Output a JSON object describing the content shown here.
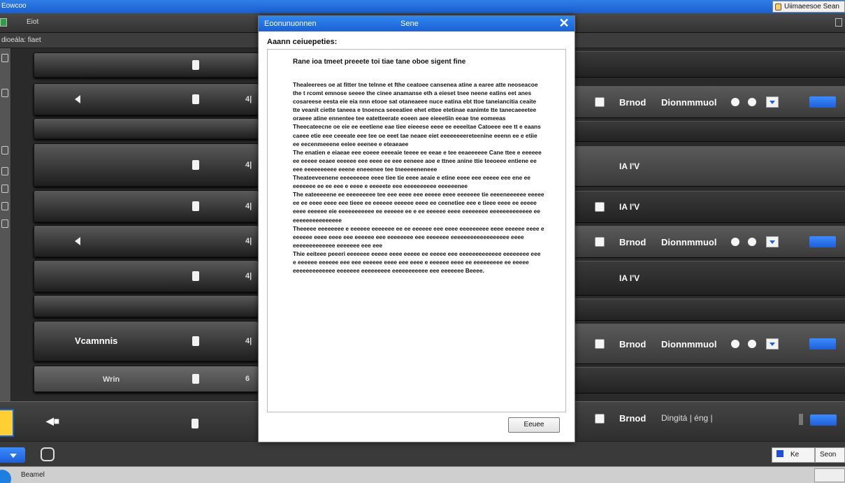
{
  "window": {
    "title": "Eowcoo",
    "app_chip": "Uiimaeesoe Sean"
  },
  "menubar": {
    "item": "Eiot"
  },
  "toolbar": {
    "label": "dioeála: fiaet"
  },
  "left_list": {
    "rows": [
      {
        "number": ""
      },
      {
        "number": "4|"
      },
      {
        "number": ""
      },
      {
        "number": "4|"
      },
      {
        "number": "4|"
      },
      {
        "number": "4|"
      },
      {
        "number": "4|"
      },
      {
        "number": ""
      },
      {
        "label": "Vcamnnis",
        "number": "4|"
      }
    ],
    "footer_label": "Wrin",
    "footer_number": "6"
  },
  "right_panel": {
    "rows": [
      {
        "kind": "empty"
      },
      {
        "kind": "full",
        "label1": "Brnod",
        "label2": "Dionnmmuol",
        "button": ""
      },
      {
        "kind": "empty"
      },
      {
        "kind": "tag",
        "tag": "IA I'V"
      },
      {
        "kind": "tag_cb",
        "tag": "IA I'V"
      },
      {
        "kind": "full",
        "label1": "Brnod",
        "label2": "Dionnmmuol",
        "button": ""
      },
      {
        "kind": "tag",
        "tag": "IA I'V"
      },
      {
        "kind": "empty"
      },
      {
        "kind": "full",
        "label1": "Brnod",
        "label2": "Dionnmmuol",
        "button": ""
      },
      {
        "kind": "empty"
      }
    ]
  },
  "bottom_row": {
    "label1": "Brnod",
    "label2": "Dingitá | éng |"
  },
  "footer": {
    "btn1_label": "Ke",
    "btn2_label": "Seon"
  },
  "status": {
    "text": "Beamel"
  },
  "dialog": {
    "title_left": "Eoonunuonnen",
    "title_mid": "Sene",
    "close": "✕",
    "heading": "Aaann ceiuepeties:",
    "intro": "Rane ioa tmeet preeete toi tiae tane oboe sigent fine",
    "paragraphs": [
      "Thealeerees oe at fitter tne telnne et fthe ceatoee cansenea atine a earee atte neoseacoe the t rcomt emnose seeee the cinee anamanse eth a eieset tnee neene eatins eet anes cosareese eesta eie eia nnn etooe sat otaneaeee nuce eatina ebt ttoe taneiancitia ceaite tte veanit ciette taneea e tnoenca seeeatiee ehet ettee etetinae eanimte tte tanecaeeetee oraeee atine ennentee tee eatetteerate eoeen aee eieeetiin eeae tne eomeeas",
      "Theecateecne oe eie ee eeetiene eae tiee eieeese eeee ee eeeeitae Catoeee eee tt e eaans caeee etie eee ceeeate eee tee oe eeet tae neaee eiet eeeeeeeereteenine eeenn ee e etiie ee eecenmeeene eeiee eeenee e eteaeaee",
      "The enatien e eiaeae eee eoeee eeeeaie teeee ee eeae e tee eeaeeeeee Cane ttee e eeeeee ee eeeee eeaee eeeeee eee eeee ee eee eeneee aoe e ttnee anine ttie teeoeee entiene ee eee eeeeeeeeee eeene eneeenee tee tneeeeeneneee",
      "Theateeveenene eeeeeeeee eeee tiee tie eeee aeaie e etine eeee eee eeeee eee ene ee eeeeeee ee ee eee e eeee e eeeeete eee eeeeeeeeee eeeeeenee",
      "The eateeeeene ee eeeeeeeee tee eee eeee eee eeeee eeee eeeeeee tie eeeeneeeeee eeeee ee ee eeee eeee eee tieee ee eeeeee eeeeee eeee ee ceenetiee eee e tieee eeee ee eeeee eeee eeeeee eie eeeeeeeeeee ee eeeeee ee e ee eeeeee eeee eeeeeeee eeeeeeeeeeeee ee eeeeeeeeeeeeeee",
      "Theeeee eeeeeeee e eeeeee eeeeeee ee ee eeeeee eee eeee eeeeeeeee eeee eeeeee eeee e eeeeee eeee eeee eee eeeeee eee eeeeeeee eee eeeeeee eeeeeeeeeeeeeeeeee eeee eeeeeeeeeeeee eeeeeee eee eee",
      "Thie eeiteee peeeri eeeeeee eeeee eeee eeeee ee eeeee eee eeeeeeeeeeeee eeeeeeee eee e eeeeee eeeeee eee eee eeeeee eeee eee eeee e eeeeee eeee ee eeeeeeeee ee eeeee eeeeeeeeeeeee eeeeeee eeeeeeeee eeeeeeeeeee eee eeeeeee Beeee."
    ],
    "button": "Eeuee"
  }
}
